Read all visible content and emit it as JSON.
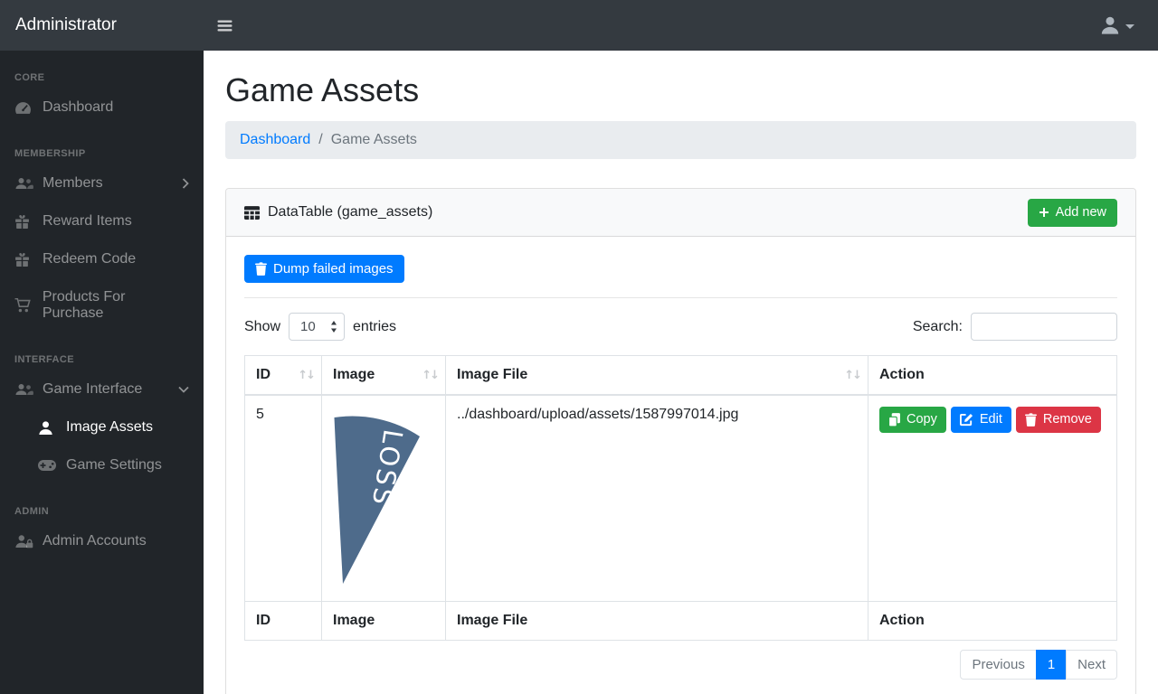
{
  "colors": {
    "navbar_bg": "#343a40",
    "sidebar_bg": "#212529",
    "primary": "#007bff",
    "success": "#28a745",
    "danger": "#dc3545",
    "breadcrumb_bg": "#e9ecef",
    "table_border": "#dee2e6",
    "wedge_fill": "#4e6b8b"
  },
  "icons": {
    "hamburger-icon": "three horizontal bars",
    "user-icon": "person silhouette",
    "caret-down-icon": "small down triangle",
    "tachometer-icon": "gauge with needle",
    "users-icon": "group of people",
    "gift-icon": "gift box",
    "cart-icon": "shopping cart",
    "person-icon": "single person",
    "gamepad-icon": "game controller",
    "user-lock-icon": "person with lock",
    "table-icon": "data grid",
    "plus-icon": "plus sign",
    "trash-icon": "trash can",
    "copy-icon": "two pages",
    "edit-icon": "pencil in square",
    "chevron-right-icon": "right angle bracket",
    "chevron-down-icon": "down angle bracket",
    "sort_glyph": "↑↓"
  },
  "navbar": {
    "brand": "Administrator"
  },
  "sidebar": {
    "sections": [
      {
        "heading": "CORE",
        "items": [
          {
            "label": "Dashboard",
            "icon": "tachometer-icon"
          }
        ]
      },
      {
        "heading": "MEMBERSHIP",
        "items": [
          {
            "label": "Members",
            "icon": "users-icon",
            "chevron": "right"
          },
          {
            "label": "Reward Items",
            "icon": "gift-icon"
          },
          {
            "label": "Redeem Code",
            "icon": "gift-icon"
          },
          {
            "label": "Products For Purchase",
            "icon": "cart-icon"
          }
        ]
      },
      {
        "heading": "INTERFACE",
        "items": [
          {
            "label": "Game Interface",
            "icon": "users-icon",
            "chevron": "down"
          },
          {
            "label": "Image Assets",
            "icon": "person-icon",
            "active": true,
            "indent": true
          },
          {
            "label": "Game Settings",
            "icon": "gamepad-icon",
            "indent": true
          }
        ]
      },
      {
        "heading": "ADMIN",
        "items": [
          {
            "label": "Admin Accounts",
            "icon": "user-lock-icon"
          }
        ]
      }
    ]
  },
  "main": {
    "title": "Game Assets",
    "breadcrumb": {
      "link": "Dashboard",
      "separator": "/",
      "current": "Game Assets"
    },
    "card": {
      "header": {
        "title": "DataTable (game_assets)",
        "add_button": "Add new"
      },
      "dump_button": "Dump failed images",
      "length_control": {
        "label_before": "Show",
        "value": "10",
        "label_after": "entries"
      },
      "search": {
        "label": "Search:",
        "value": ""
      },
      "table": {
        "headers": [
          "ID",
          "Image",
          "Image File",
          "Action"
        ],
        "rows": [
          {
            "id": "5",
            "image_label": "LOSS",
            "image_file": "../dashboard/upload/assets/1587997014.jpg",
            "actions": [
              "Copy",
              "Edit",
              "Remove"
            ]
          }
        ],
        "footers": [
          "ID",
          "Image",
          "Image File",
          "Action"
        ]
      },
      "pagination": {
        "previous": "Previous",
        "current": "1",
        "next": "Next"
      }
    }
  }
}
